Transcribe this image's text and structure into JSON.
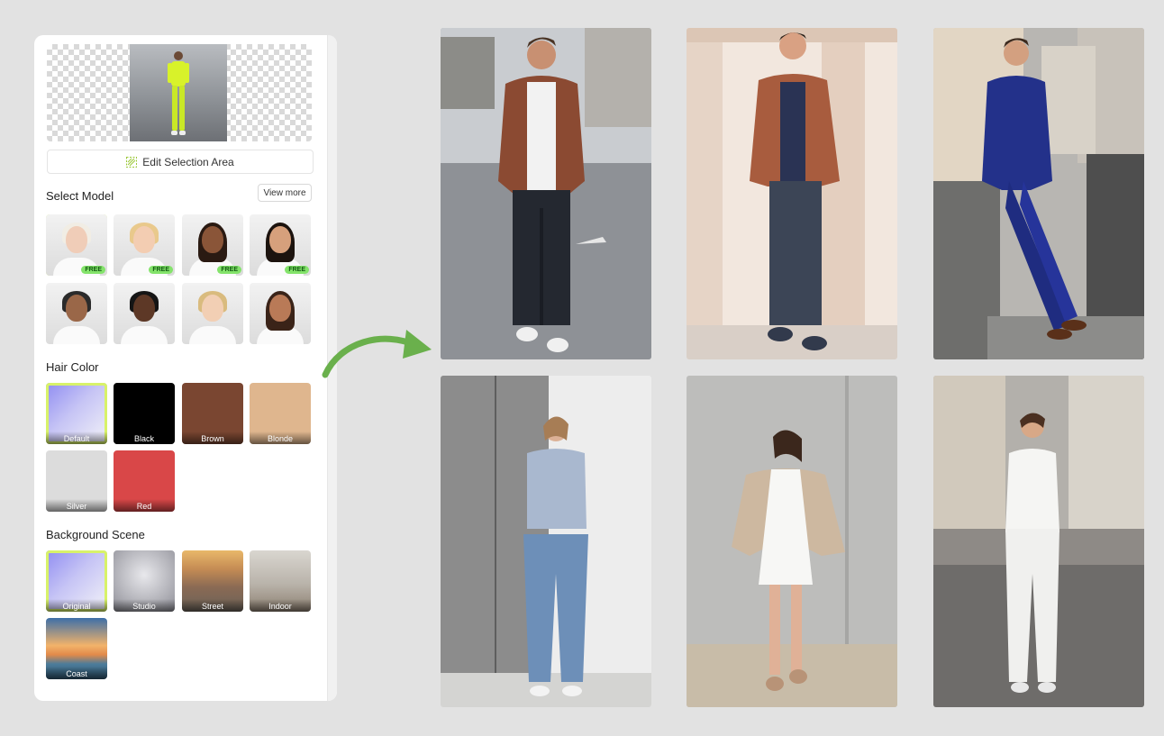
{
  "panel": {
    "edit_selection_label": "Edit Selection Area",
    "select_model": {
      "title": "Select Model",
      "view_more_label": "View more",
      "badge_label": "FREE",
      "models": [
        {
          "name": "model-1",
          "free": true,
          "skin": "#f0cdb8",
          "hair": "#f1ede4"
        },
        {
          "name": "model-2",
          "free": true,
          "skin": "#f3cdb2",
          "hair": "#e9c98c"
        },
        {
          "name": "model-3",
          "free": true,
          "skin": "#8a5538",
          "hair": "#2a1a12"
        },
        {
          "name": "model-4",
          "free": true,
          "skin": "#d6a07c",
          "hair": "#1c130e"
        },
        {
          "name": "model-5",
          "free": false,
          "skin": "#9a6748",
          "hair": "#2b2b2b"
        },
        {
          "name": "model-6",
          "free": false,
          "skin": "#5d3826",
          "hair": "#151515"
        },
        {
          "name": "model-7",
          "free": false,
          "skin": "#f2cfb4",
          "hair": "#d9bb7e"
        },
        {
          "name": "model-8",
          "free": false,
          "skin": "#b97a57",
          "hair": "#3a2318"
        }
      ]
    },
    "hair_color": {
      "title": "Hair Color",
      "options": [
        {
          "label": "Default",
          "color": "gradient-default",
          "selected": true
        },
        {
          "label": "Black",
          "color": "#000000",
          "selected": false
        },
        {
          "label": "Brown",
          "color": "#7a4631",
          "selected": false
        },
        {
          "label": "Blonde",
          "color": "#dfb68e",
          "selected": false
        },
        {
          "label": "Silver",
          "color": "#dcdcdc",
          "selected": false
        },
        {
          "label": "Red",
          "color": "#d94748",
          "selected": false
        }
      ]
    },
    "background_scene": {
      "title": "Background Scene",
      "options": [
        {
          "label": "Original",
          "selected": true
        },
        {
          "label": "Studio",
          "selected": false
        },
        {
          "label": "Street",
          "selected": false
        },
        {
          "label": "Indoor",
          "selected": false
        },
        {
          "label": "Coast",
          "selected": false
        }
      ]
    }
  },
  "accent_color": "#d8f26a",
  "arrow_color": "#6ab04c",
  "results": [
    {
      "name": "result-street-man-brown-jacket"
    },
    {
      "name": "result-columns-man-brown-shirt"
    },
    {
      "name": "result-city-man-blue-suit"
    },
    {
      "name": "result-elevator-woman-jeans"
    },
    {
      "name": "result-wall-woman-white-dress"
    },
    {
      "name": "result-street-woman-white-suit"
    }
  ]
}
